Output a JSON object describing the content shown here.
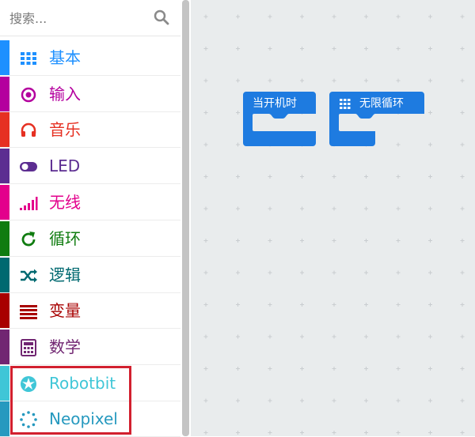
{
  "search": {
    "placeholder": "搜索..."
  },
  "categories": [
    {
      "label": "基本",
      "color": "#1e90ff",
      "icon": "grid-icon"
    },
    {
      "label": "输入",
      "color": "#b4009e",
      "icon": "target-icon"
    },
    {
      "label": "音乐",
      "color": "#e63022",
      "icon": "headphones-icon"
    },
    {
      "label": "LED",
      "color": "#5c2d91",
      "icon": "toggle-icon"
    },
    {
      "label": "无线",
      "color": "#e3008c",
      "icon": "signal-icon"
    },
    {
      "label": "循环",
      "color": "#107c10",
      "icon": "refresh-icon"
    },
    {
      "label": "逻辑",
      "color": "#006970",
      "icon": "shuffle-icon"
    },
    {
      "label": "变量",
      "color": "#a80000",
      "icon": "list-icon"
    },
    {
      "label": "数学",
      "color": "#712672",
      "icon": "calculator-icon"
    },
    {
      "label": "Robotbit",
      "color": "#3fc6d7",
      "icon": "rebel-icon"
    },
    {
      "label": "Neopixel",
      "color": "#2699bf",
      "icon": "dotted-circle-icon"
    }
  ],
  "workspace": {
    "blocks": [
      {
        "label": "当开机时"
      },
      {
        "label": "无限循环"
      }
    ],
    "block_color": "#1e7be0"
  }
}
